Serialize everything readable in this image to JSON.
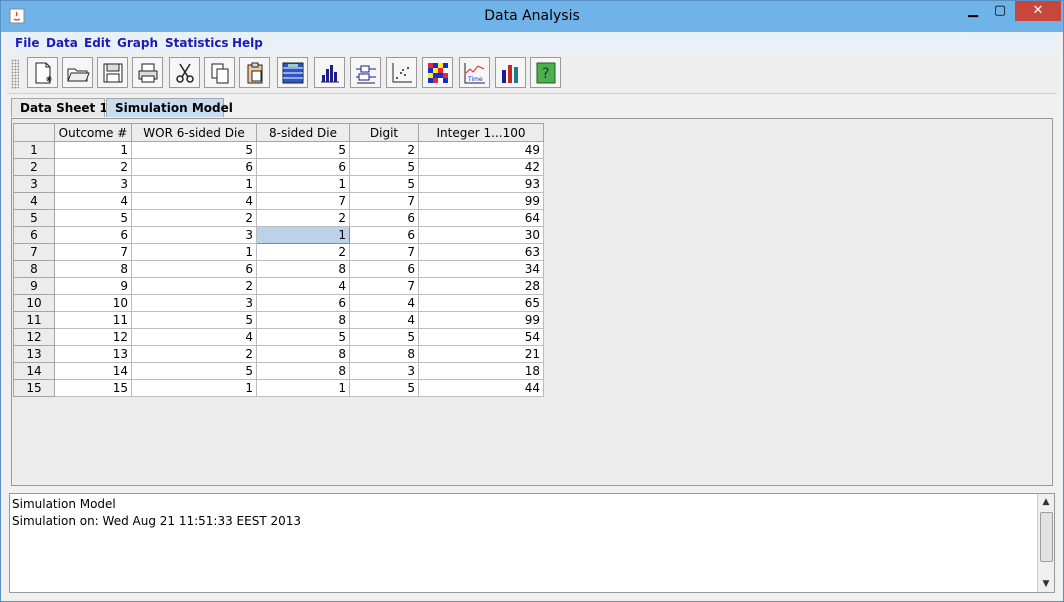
{
  "window": {
    "title": "Data Analysis",
    "close_glyph": "✕",
    "min_glyph": "▁",
    "max_glyph": "▢"
  },
  "menu": [
    "File",
    "Data",
    "Edit",
    "Graph",
    "Statistics",
    "Help"
  ],
  "toolbar": [
    {
      "name": "new-file-icon"
    },
    {
      "name": "open-folder-icon"
    },
    {
      "name": "save-icon"
    },
    {
      "name": "print-icon"
    },
    {
      "name": "cut-icon"
    },
    {
      "name": "copy-icon"
    },
    {
      "name": "paste-icon"
    },
    {
      "name": "spreadsheet-icon"
    },
    {
      "name": "histogram-icon"
    },
    {
      "name": "boxplot-icon"
    },
    {
      "name": "scatterplot-icon"
    },
    {
      "name": "heatmap-icon"
    },
    {
      "name": "time-series-icon"
    },
    {
      "name": "bar-chart-icon"
    },
    {
      "name": "help-icon"
    }
  ],
  "tabs": [
    "Data Sheet 1",
    "Simulation Model"
  ],
  "table": {
    "columns": [
      "Outcome #",
      "WOR 6-sided Die",
      "8-sided Die",
      "Digit",
      "Integer 1...100"
    ],
    "rows": [
      [
        "1",
        "5",
        "5",
        "2",
        "49"
      ],
      [
        "2",
        "6",
        "6",
        "5",
        "42"
      ],
      [
        "3",
        "1",
        "1",
        "5",
        "93"
      ],
      [
        "4",
        "4",
        "7",
        "7",
        "99"
      ],
      [
        "5",
        "2",
        "2",
        "6",
        "64"
      ],
      [
        "6",
        "3",
        "1",
        "6",
        "30"
      ],
      [
        "7",
        "1",
        "2",
        "7",
        "63"
      ],
      [
        "8",
        "6",
        "8",
        "6",
        "34"
      ],
      [
        "9",
        "2",
        "4",
        "7",
        "28"
      ],
      [
        "10",
        "3",
        "6",
        "4",
        "65"
      ],
      [
        "11",
        "5",
        "8",
        "4",
        "99"
      ],
      [
        "12",
        "4",
        "5",
        "5",
        "54"
      ],
      [
        "13",
        "2",
        "8",
        "8",
        "21"
      ],
      [
        "14",
        "5",
        "8",
        "3",
        "18"
      ],
      [
        "15",
        "1",
        "1",
        "5",
        "44"
      ]
    ],
    "row_headers": [
      "1",
      "2",
      "3",
      "4",
      "5",
      "6",
      "7",
      "8",
      "9",
      "10",
      "11",
      "12",
      "13",
      "14",
      "15"
    ],
    "selected": {
      "row": 5,
      "col": 2
    }
  },
  "log": {
    "line1": "Simulation Model",
    "line2": " Simulation on: Wed Aug 21 11:51:33 EEST 2013"
  }
}
